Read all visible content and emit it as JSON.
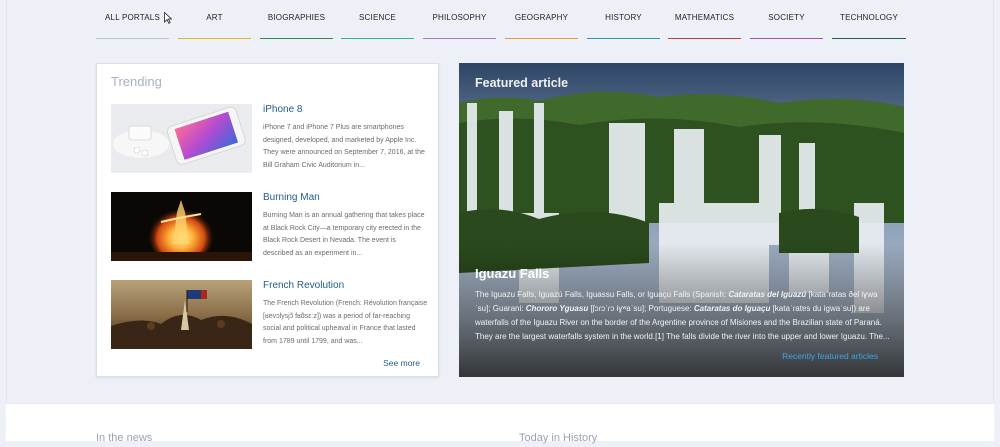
{
  "nav": {
    "items": [
      {
        "label": "ALL PORTALS",
        "color": "#bfc3cc"
      },
      {
        "label": "ART",
        "color": "#e8b529"
      },
      {
        "label": "BIOGRAPHIES",
        "color": "#2d8a4e"
      },
      {
        "label": "SCIENCE",
        "color": "#2bb3a3"
      },
      {
        "label": "PHILOSOPHY",
        "color": "#b07cc0"
      },
      {
        "label": "GEOGRAPHY",
        "color": "#e89a35"
      },
      {
        "label": "HISTORY",
        "color": "#2a9c96"
      },
      {
        "label": "MATHEMATICS",
        "color": "#b8403d"
      },
      {
        "label": "SOCIETY",
        "color": "#a64fae"
      },
      {
        "label": "TECHNOLOGY",
        "color": "#1e5f66"
      }
    ]
  },
  "trending": {
    "title": "Trending",
    "items": [
      {
        "heading": "iPhone 8",
        "text": "iPhone 7 and iPhone 7 Plus are smartphones designed, developed, and marketed by Apple Inc. They were announced on September 7, 2016, at the Bill Graham Civic Auditorium in...",
        "thumb_icon": "phone-image"
      },
      {
        "heading": "Burning Man",
        "text": "Burning Man is an annual gathering that takes place at Black Rock City—a temporary city erected in the Black Rock Desert in Nevada. The event is described as an experiment in...",
        "thumb_icon": "fire-image"
      },
      {
        "heading": "French Revolution",
        "text": "The French Revolution (French: Révolution française [ʁevɔlysjɔ̃ fʁɑ̃sɛːz]) was a period of far-reaching social and political upheaval in France that lasted from 1789 until 1799, and was...",
        "thumb_icon": "painting-image"
      }
    ],
    "see_more": "See more"
  },
  "featured": {
    "label": "Featured article",
    "title": "Iguazu Falls",
    "text_parts": {
      "p1": "The Iguazu Falls, Iguazú Falls, Iguassu Falls, or Iguaçu Falls (Spanish: ",
      "p2": "Cataratas del Iguazú",
      "p3": " [kataˈɾatas ðel iɣwaˈsu]; Guarani: ",
      "p4": "Chororo Yguasu",
      "p5": " [ʃɔɾɔˈɾɔ ɨɣʷaˈsu]; Portuguese: ",
      "p6": "Cataratas do Iguaçu",
      "p7": " [kataˈɾatɐs du iɡwaˈsu]) are waterfalls of the Iguazu River on the border of the Argentine province of Misiones and the Brazilian state of Paraná. They are the largest waterfalls system in the world.[1] The falls divide the river into the upper and lower Iguazu. The..."
    },
    "recent_link": "Recently featured articles"
  },
  "lower": {
    "left_heading": "In the news",
    "right_heading": "Today in History"
  }
}
